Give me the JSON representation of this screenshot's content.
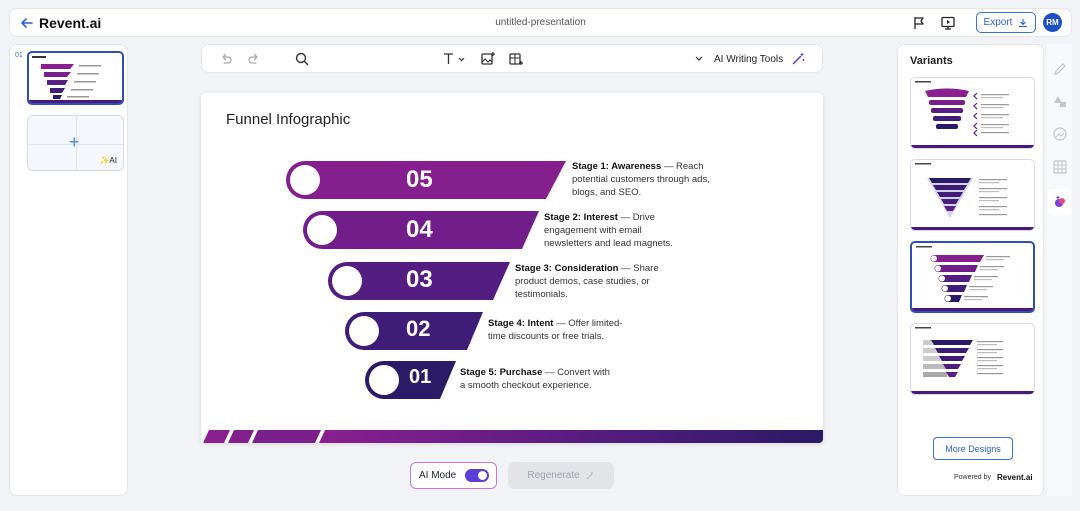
{
  "header": {
    "brand": "Revent.ai",
    "doc_title": "untitled-presentation",
    "export_label": "Export",
    "avatar_initials": "RM"
  },
  "slides_panel": {
    "slide_number": "01",
    "add_ai_label": "✨AI"
  },
  "toolbar": {
    "ai_tools_label": "AI Writing Tools"
  },
  "slide": {
    "title": "Funnel Infographic",
    "stages": [
      {
        "num": "05",
        "title": "Stage 1: Awareness",
        "desc_l1": " — Reach",
        "desc_l2": "potential customers through ads,",
        "desc_l3": "blogs, and SEO."
      },
      {
        "num": "04",
        "title": "Stage 2: Interest",
        "desc_l1": " — Drive",
        "desc_l2": "engagement with email",
        "desc_l3": "newsletters and lead magnets."
      },
      {
        "num": "03",
        "title": "Stage 3: Consideration",
        "desc_l1": " — Share",
        "desc_l2": "product demos, case studies, or",
        "desc_l3": "testimonials."
      },
      {
        "num": "02",
        "title": "Stage 4: Intent",
        "desc_l1": " — Offer limited-",
        "desc_l2": "time discounts or free trials.",
        "desc_l3": ""
      },
      {
        "num": "01",
        "title": "Stage 5: Purchase",
        "desc_l1": " — Convert with",
        "desc_l2": "a smooth checkout experience.",
        "desc_l3": ""
      }
    ],
    "colors": {
      "funnel_light": "#8a1f8f",
      "funnel_dark": "#2b1a66"
    }
  },
  "bottom": {
    "ai_mode_label": "AI Mode",
    "regenerate_label": "Regenerate"
  },
  "variants": {
    "title": "Variants",
    "more_designs_label": "More Designs",
    "powered_by": "Powered by",
    "powered_brand": "Revent.ai"
  }
}
